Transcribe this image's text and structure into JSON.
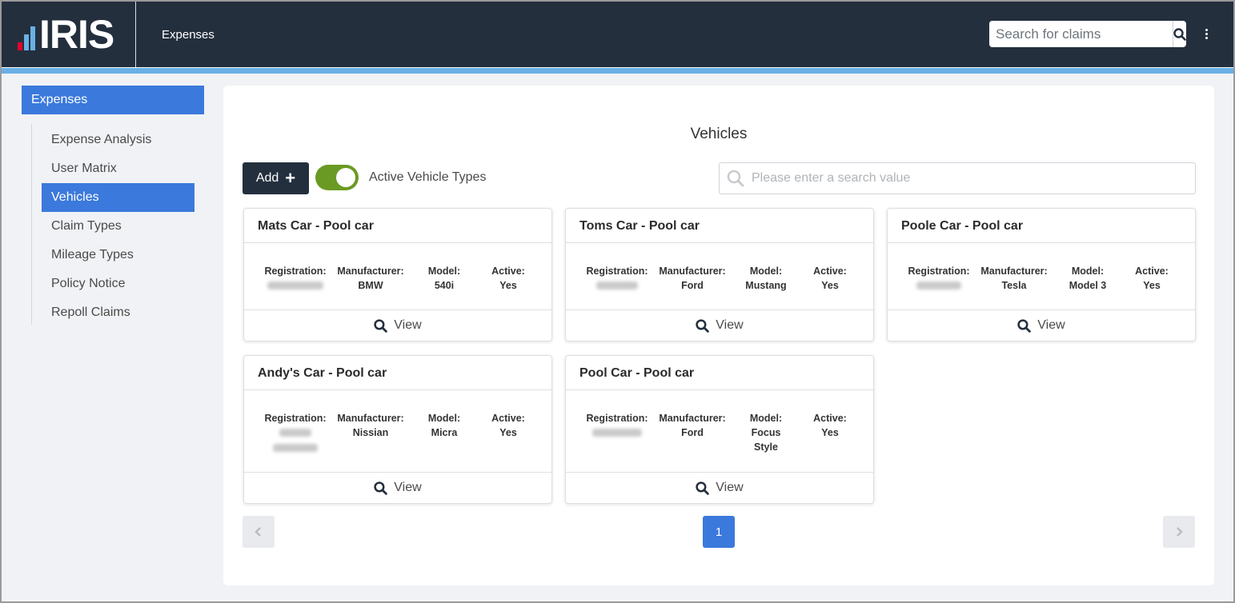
{
  "header": {
    "logo_text": "IRIS",
    "app_title": "Expenses",
    "search_placeholder": "Search for claims"
  },
  "sidebar": {
    "header": "Expenses",
    "items": [
      {
        "label": "Expense Analysis",
        "active": false
      },
      {
        "label": "User Matrix",
        "active": false
      },
      {
        "label": "Vehicles",
        "active": true
      },
      {
        "label": "Claim Types",
        "active": false
      },
      {
        "label": "Mileage Types",
        "active": false
      },
      {
        "label": "Policy Notice",
        "active": false
      },
      {
        "label": "Repoll Claims",
        "active": false
      }
    ]
  },
  "main": {
    "title": "Vehicles",
    "add_label": "Add",
    "toggle_label": "Active Vehicle Types",
    "toggle_on": true,
    "search_placeholder": "Please enter a search value",
    "labels": {
      "registration": "Registration:",
      "manufacturer": "Manufacturer:",
      "model": "Model:",
      "active": "Active:",
      "view": "View"
    },
    "vehicles": [
      {
        "title": "Mats Car - Pool car",
        "manufacturer": "BMW",
        "model": "540i",
        "active": "Yes"
      },
      {
        "title": "Toms Car - Pool car",
        "manufacturer": "Ford",
        "model": "Mustang",
        "active": "Yes"
      },
      {
        "title": "Poole Car - Pool car",
        "manufacturer": "Tesla",
        "model": "Model 3",
        "active": "Yes"
      },
      {
        "title": "Andy's Car - Pool car",
        "manufacturer": "Nissian",
        "model": "Micra",
        "active": "Yes"
      },
      {
        "title": "Pool Car - Pool car",
        "manufacturer": "Ford",
        "model": "Focus Style",
        "active": "Yes"
      }
    ],
    "pagination": {
      "current": "1"
    }
  },
  "colors": {
    "topbar": "#242f3e",
    "accent": "#3b79dc",
    "toggle_on": "#6a9a23",
    "logo_red": "#e4002b",
    "logo_blue": "#69b0e5"
  }
}
